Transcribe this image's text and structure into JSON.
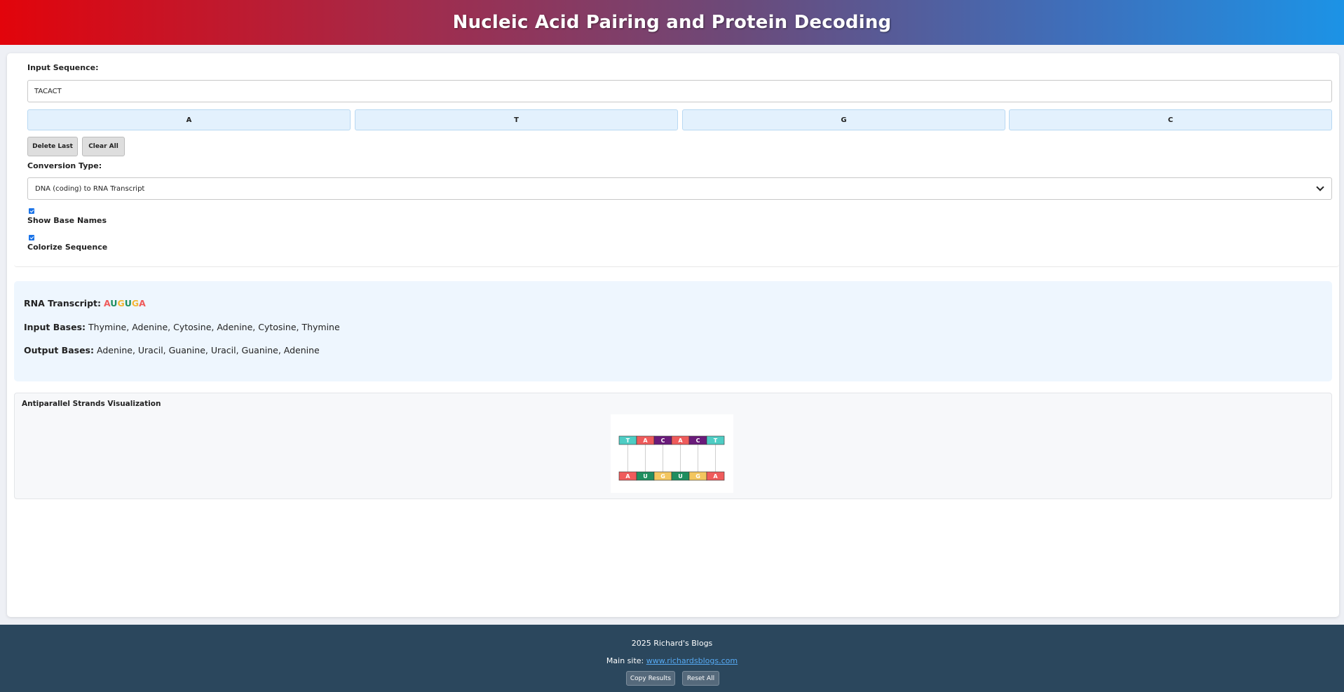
{
  "header": {
    "title": "Nucleic Acid Pairing and Protein Decoding"
  },
  "input": {
    "label": "Input Sequence:",
    "value": "TACACT",
    "base_buttons": [
      "A",
      "T",
      "G",
      "C"
    ],
    "delete_label": "Delete Last",
    "clear_label": "Clear All"
  },
  "conversion": {
    "label": "Conversion Type:",
    "selected": "DNA (coding) to RNA Transcript"
  },
  "options": {
    "show_base_names": {
      "label": "Show Base Names",
      "checked": true
    },
    "colorize_sequence": {
      "label": "Colorize Sequence",
      "checked": true
    }
  },
  "results": {
    "rna_label": "RNA Transcript:",
    "rna_letters": [
      {
        "letter": "A",
        "color": "#ef5b5b"
      },
      {
        "letter": "U",
        "color": "#1e8e5f"
      },
      {
        "letter": "G",
        "color": "#f3b634"
      },
      {
        "letter": "U",
        "color": "#1e8e5f"
      },
      {
        "letter": "G",
        "color": "#f3b634"
      },
      {
        "letter": "A",
        "color": "#ef5b5b"
      }
    ],
    "input_bases_label": "Input Bases:",
    "input_bases": "Thymine, Adenine, Cytosine, Adenine, Cytosine, Thymine",
    "output_bases_label": "Output Bases:",
    "output_bases": "Adenine, Uracil, Guanine, Uracil, Guanine, Adenine"
  },
  "visualization": {
    "title": "Antiparallel Strands Visualization",
    "top_strand": [
      {
        "base": "T",
        "color": "#4ecdc4"
      },
      {
        "base": "A",
        "color": "#ef5b5b"
      },
      {
        "base": "C",
        "color": "#6a1b7a"
      },
      {
        "base": "A",
        "color": "#ef5b5b"
      },
      {
        "base": "C",
        "color": "#6a1b7a"
      },
      {
        "base": "T",
        "color": "#4ecdc4"
      }
    ],
    "bottom_strand": [
      {
        "base": "A",
        "color": "#ef5b5b"
      },
      {
        "base": "U",
        "color": "#1e8e5f"
      },
      {
        "base": "G",
        "color": "#f3c65f"
      },
      {
        "base": "U",
        "color": "#1e8e5f"
      },
      {
        "base": "G",
        "color": "#f3c65f"
      },
      {
        "base": "A",
        "color": "#ef5b5b"
      }
    ]
  },
  "footer": {
    "copyright": "2025 Richard's Blogs",
    "main_site_label": "Main site:",
    "main_site_link": "www.richardsblogs.com",
    "copy_results_label": "Copy Results",
    "reset_all_label": "Reset All"
  }
}
